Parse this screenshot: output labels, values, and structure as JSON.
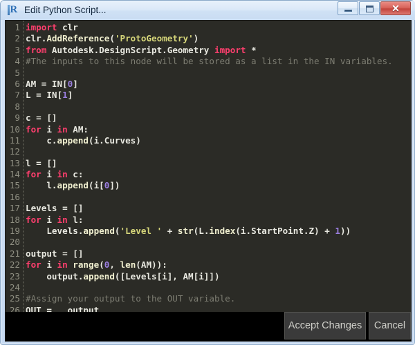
{
  "window": {
    "title": "Edit Python Script...",
    "icon": "dynamo-r-icon",
    "icon_letter": "R",
    "controls": {
      "minimize_label": "–",
      "maximize_label": "□",
      "close_label": "✕"
    }
  },
  "theme": {
    "titlebar_bg": "#cfe1f5",
    "editor_bg": "#2b2b26",
    "footer_bg": "#000000",
    "gutter_fg": "#8f8f82",
    "text_fg": "#e8e8e0",
    "keyword_fg": "#ff3f6e",
    "string_fg": "#d6d67a",
    "number_fg": "#9b7fe0",
    "comment_fg": "#7d7d72",
    "function_fg": "#f0efcf",
    "button_bg": "#3a3a3a",
    "button_fg": "#cfcfc9",
    "close_button_bg": "#c2443c"
  },
  "editor": {
    "language": "python",
    "line_count": 26,
    "lines": [
      {
        "n": "1",
        "tokens": [
          {
            "t": "import",
            "c": "kw"
          },
          {
            "t": " clr",
            "c": "pl"
          }
        ]
      },
      {
        "n": "2",
        "tokens": [
          {
            "t": "clr.",
            "c": "pl"
          },
          {
            "t": "AddReference",
            "c": "fn"
          },
          {
            "t": "(",
            "c": "pl"
          },
          {
            "t": "'ProtoGeometry'",
            "c": "str"
          },
          {
            "t": ")",
            "c": "pl"
          }
        ]
      },
      {
        "n": "3",
        "tokens": [
          {
            "t": "from",
            "c": "kw"
          },
          {
            "t": " Autodesk.DesignScript.Geometry ",
            "c": "pl"
          },
          {
            "t": "import",
            "c": "kw"
          },
          {
            "t": " *",
            "c": "pl"
          }
        ]
      },
      {
        "n": "4",
        "tokens": [
          {
            "t": "#The inputs to this node will be stored as a list in the IN variables.",
            "c": "com"
          }
        ]
      },
      {
        "n": "5",
        "tokens": []
      },
      {
        "n": "6",
        "tokens": [
          {
            "t": "AM = IN[",
            "c": "pl"
          },
          {
            "t": "0",
            "c": "num2"
          },
          {
            "t": "]",
            "c": "pl"
          }
        ]
      },
      {
        "n": "7",
        "tokens": [
          {
            "t": "L = IN[",
            "c": "pl"
          },
          {
            "t": "1",
            "c": "num2"
          },
          {
            "t": "]",
            "c": "pl"
          }
        ]
      },
      {
        "n": "8",
        "tokens": []
      },
      {
        "n": "9",
        "tokens": [
          {
            "t": "c = []",
            "c": "pl"
          }
        ]
      },
      {
        "n": "10",
        "tokens": [
          {
            "t": "for",
            "c": "kw"
          },
          {
            "t": " i ",
            "c": "pl"
          },
          {
            "t": "in",
            "c": "kw"
          },
          {
            "t": " AM:",
            "c": "pl"
          }
        ]
      },
      {
        "n": "11",
        "tokens": [
          {
            "t": "    c.",
            "c": "pl"
          },
          {
            "t": "append",
            "c": "fn"
          },
          {
            "t": "(i.Curves)",
            "c": "pl"
          }
        ]
      },
      {
        "n": "12",
        "tokens": []
      },
      {
        "n": "13",
        "tokens": [
          {
            "t": "l = []",
            "c": "pl"
          }
        ]
      },
      {
        "n": "14",
        "tokens": [
          {
            "t": "for",
            "c": "kw"
          },
          {
            "t": " i ",
            "c": "pl"
          },
          {
            "t": "in",
            "c": "kw"
          },
          {
            "t": " c:",
            "c": "pl"
          }
        ]
      },
      {
        "n": "15",
        "tokens": [
          {
            "t": "    l.",
            "c": "pl"
          },
          {
            "t": "append",
            "c": "fn"
          },
          {
            "t": "(i[",
            "c": "pl"
          },
          {
            "t": "0",
            "c": "num2"
          },
          {
            "t": "])",
            "c": "pl"
          }
        ]
      },
      {
        "n": "16",
        "tokens": []
      },
      {
        "n": "17",
        "tokens": [
          {
            "t": "Levels = []",
            "c": "pl"
          }
        ]
      },
      {
        "n": "18",
        "tokens": [
          {
            "t": "for",
            "c": "kw"
          },
          {
            "t": " i ",
            "c": "pl"
          },
          {
            "t": "in",
            "c": "kw"
          },
          {
            "t": " l:",
            "c": "pl"
          }
        ]
      },
      {
        "n": "19",
        "tokens": [
          {
            "t": "    Levels.",
            "c": "pl"
          },
          {
            "t": "append",
            "c": "fn"
          },
          {
            "t": "(",
            "c": "pl"
          },
          {
            "t": "'Level '",
            "c": "str"
          },
          {
            "t": " + ",
            "c": "pl"
          },
          {
            "t": "str",
            "c": "fn"
          },
          {
            "t": "(L.",
            "c": "pl"
          },
          {
            "t": "index",
            "c": "fn"
          },
          {
            "t": "(i.StartPoint.Z) + ",
            "c": "pl"
          },
          {
            "t": "1",
            "c": "num2"
          },
          {
            "t": "))",
            "c": "pl"
          }
        ]
      },
      {
        "n": "20",
        "tokens": []
      },
      {
        "n": "21",
        "tokens": [
          {
            "t": "output = []",
            "c": "pl"
          }
        ]
      },
      {
        "n": "22",
        "tokens": [
          {
            "t": "for",
            "c": "kw"
          },
          {
            "t": " i ",
            "c": "pl"
          },
          {
            "t": "in",
            "c": "kw"
          },
          {
            "t": " ",
            "c": "pl"
          },
          {
            "t": "range",
            "c": "fn"
          },
          {
            "t": "(",
            "c": "pl"
          },
          {
            "t": "0",
            "c": "num2"
          },
          {
            "t": ", ",
            "c": "pl"
          },
          {
            "t": "len",
            "c": "fn"
          },
          {
            "t": "(AM)):",
            "c": "pl"
          }
        ]
      },
      {
        "n": "23",
        "tokens": [
          {
            "t": "    output.",
            "c": "pl"
          },
          {
            "t": "append",
            "c": "fn"
          },
          {
            "t": "([Levels[i], AM[i]])",
            "c": "pl"
          }
        ]
      },
      {
        "n": "24",
        "tokens": []
      },
      {
        "n": "25",
        "tokens": [
          {
            "t": "#Assign your output to the OUT variable.",
            "c": "com"
          }
        ]
      },
      {
        "n": "26",
        "tokens": [
          {
            "t": "OUT =   output",
            "c": "pl"
          }
        ]
      }
    ]
  },
  "footer": {
    "accept_label": "Accept Changes",
    "cancel_label": "Cancel"
  }
}
